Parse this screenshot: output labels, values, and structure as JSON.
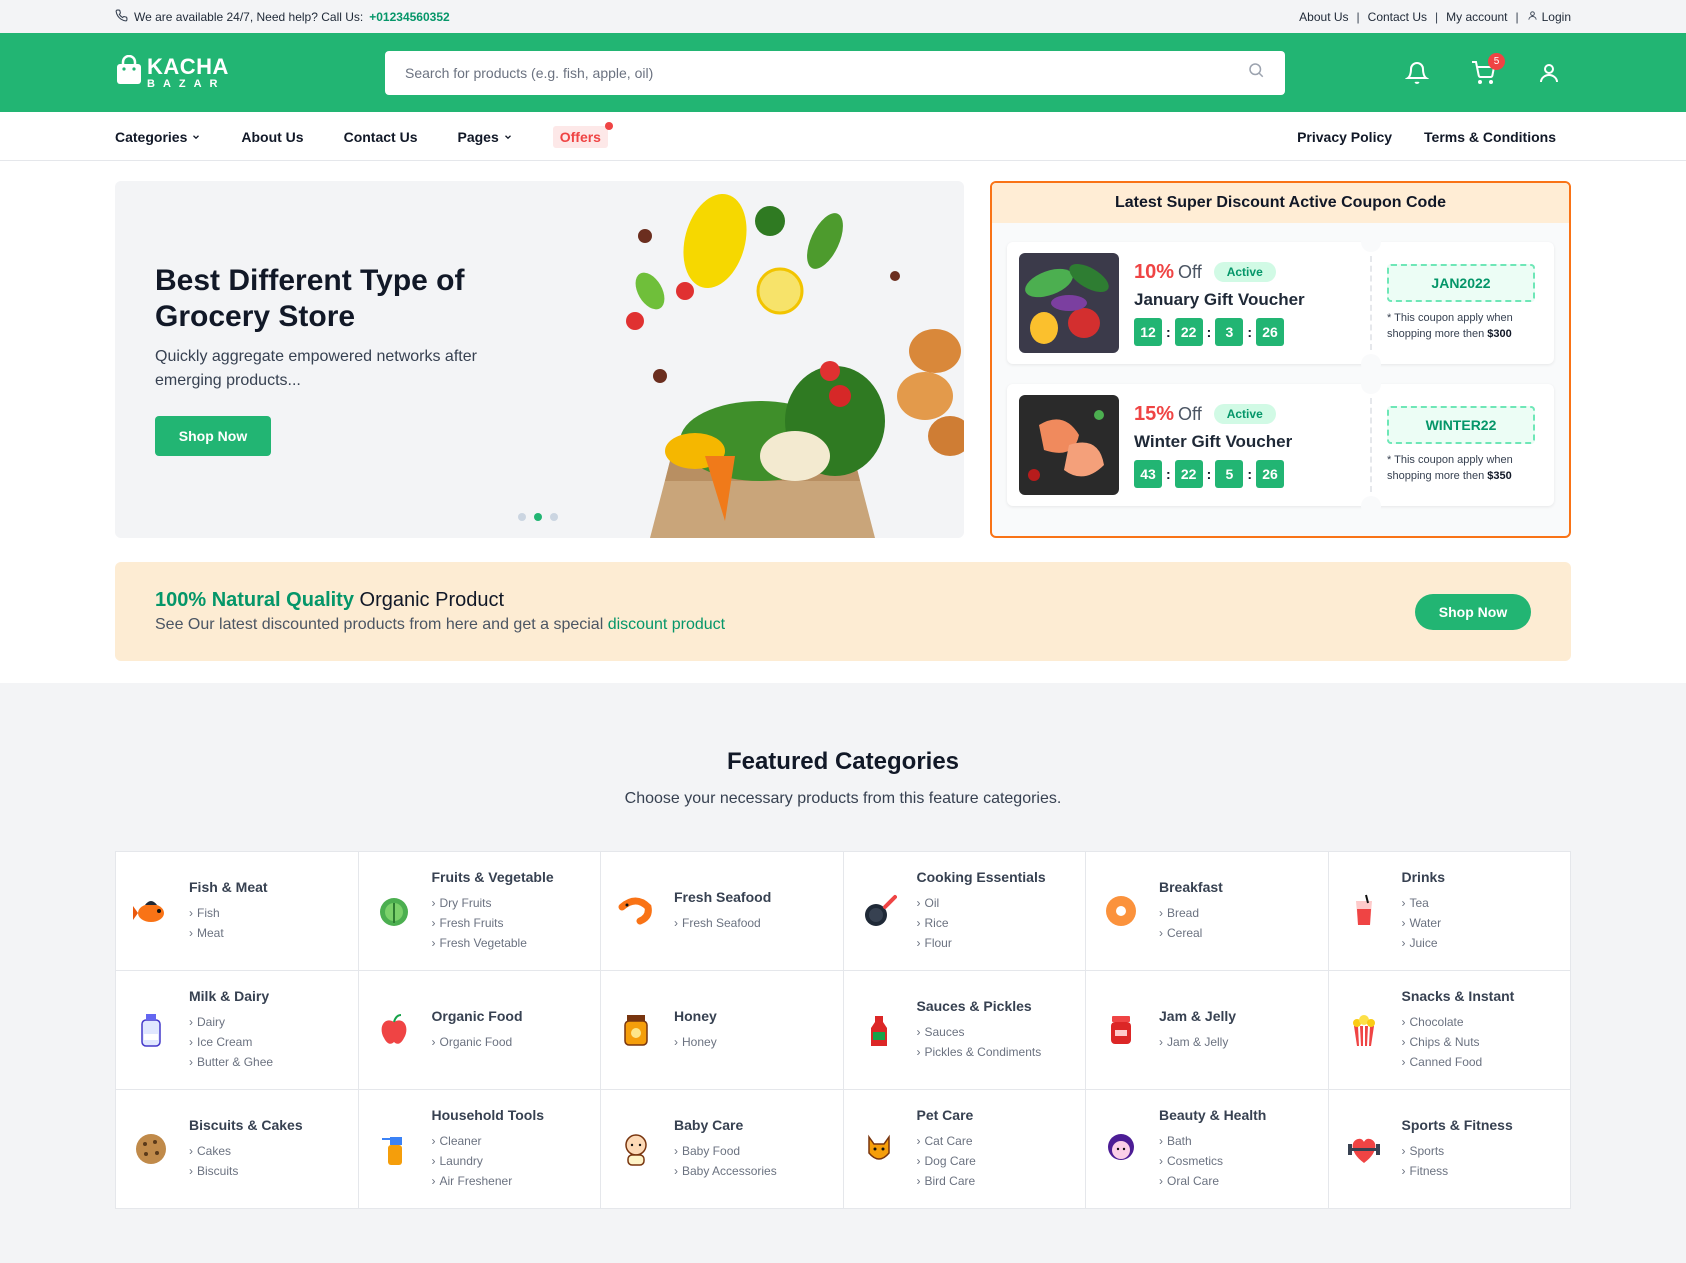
{
  "topbar": {
    "help_text": "We are available 24/7, Need help? Call Us:",
    "phone": "+01234560352",
    "links": [
      "About Us",
      "Contact Us",
      "My account"
    ],
    "login": "Login"
  },
  "header": {
    "logo_main": "KACHA",
    "logo_sub": "BAZAR",
    "search_placeholder": "Search for products (e.g. fish, apple, oil)",
    "cart_count": "5"
  },
  "nav": {
    "categories": "Categories",
    "about": "About Us",
    "contact": "Contact Us",
    "pages": "Pages",
    "offers": "Offers",
    "privacy": "Privacy Policy",
    "terms": "Terms & Conditions"
  },
  "hero": {
    "title": "Best Different Type of Grocery Store",
    "description": "Quickly aggregate empowered networks after emerging products...",
    "button": "Shop Now",
    "active_slide": 2,
    "slides": 3
  },
  "coupons": {
    "heading": "Latest Super Discount Active Coupon Code",
    "items": [
      {
        "percent": "10%",
        "off": "Off",
        "status": "Active",
        "name": "January Gift Voucher",
        "timer": [
          "12",
          "22",
          "3",
          "26"
        ],
        "code": "JAN2022",
        "note": "* This coupon apply when shopping more then",
        "min": "$300"
      },
      {
        "percent": "15%",
        "off": "Off",
        "status": "Active",
        "name": "Winter Gift Voucher",
        "timer": [
          "43",
          "22",
          "5",
          "26"
        ],
        "code": "WINTER22",
        "note": "* This coupon apply when shopping more then",
        "min": "$350"
      }
    ]
  },
  "promo": {
    "highlight": "100% Natural Quality",
    "title_rest": "Organic Product",
    "desc": "See Our latest discounted products from here and get a special",
    "desc_link": "discount product",
    "button": "Shop Now"
  },
  "featured": {
    "title": "Featured Categories",
    "subtitle": "Choose your necessary products from this feature categories.",
    "categories": [
      {
        "name": "Fish & Meat",
        "icon": "fish-icon",
        "subs": [
          "Fish",
          "Meat"
        ]
      },
      {
        "name": "Fruits & Vegetable",
        "icon": "cabbage-icon",
        "subs": [
          "Dry Fruits",
          "Fresh Fruits",
          "Fresh Vegetable"
        ]
      },
      {
        "name": "Fresh Seafood",
        "icon": "shrimp-icon",
        "subs": [
          "Fresh Seafood"
        ]
      },
      {
        "name": "Cooking Essentials",
        "icon": "frying-pan-icon",
        "subs": [
          "Oil",
          "Rice",
          "Flour"
        ]
      },
      {
        "name": "Breakfast",
        "icon": "donut-icon",
        "subs": [
          "Bread",
          "Cereal"
        ]
      },
      {
        "name": "Drinks",
        "icon": "juice-icon",
        "subs": [
          "Tea",
          "Water",
          "Juice"
        ]
      },
      {
        "name": "Milk & Dairy",
        "icon": "milk-icon",
        "subs": [
          "Dairy",
          "Ice Cream",
          "Butter & Ghee"
        ]
      },
      {
        "name": "Organic Food",
        "icon": "apple-icon",
        "subs": [
          "Organic Food"
        ]
      },
      {
        "name": "Honey",
        "icon": "honey-jar-icon",
        "subs": [
          "Honey"
        ]
      },
      {
        "name": "Sauces & Pickles",
        "icon": "ketchup-icon",
        "subs": [
          "Sauces",
          "Pickles & Condiments"
        ]
      },
      {
        "name": "Jam & Jelly",
        "icon": "jam-jar-icon",
        "subs": [
          "Jam & Jelly"
        ]
      },
      {
        "name": "Snacks & Instant",
        "icon": "popcorn-icon",
        "subs": [
          "Chocolate",
          "Chips & Nuts",
          "Canned Food"
        ]
      },
      {
        "name": "Biscuits & Cakes",
        "icon": "cookie-icon",
        "subs": [
          "Cakes",
          "Biscuits"
        ]
      },
      {
        "name": "Household Tools",
        "icon": "spray-bottle-icon",
        "subs": [
          "Cleaner",
          "Laundry",
          "Air Freshener"
        ]
      },
      {
        "name": "Baby Care",
        "icon": "baby-icon",
        "subs": [
          "Baby Food",
          "Baby Accessories"
        ]
      },
      {
        "name": "Pet Care",
        "icon": "cat-icon",
        "subs": [
          "Cat Care",
          "Dog Care",
          "Bird Care"
        ]
      },
      {
        "name": "Beauty & Health",
        "icon": "woman-face-icon",
        "subs": [
          "Bath",
          "Cosmetics",
          "Oral Care"
        ]
      },
      {
        "name": "Sports & Fitness",
        "icon": "heart-dumbbell-icon",
        "subs": [
          "Sports",
          "Fitness"
        ]
      }
    ]
  },
  "colors": {
    "brand_green": "#22b573",
    "accent_red": "#ef4444",
    "coupon_border": "#f97316",
    "promo_bg": "#fdecd3"
  }
}
